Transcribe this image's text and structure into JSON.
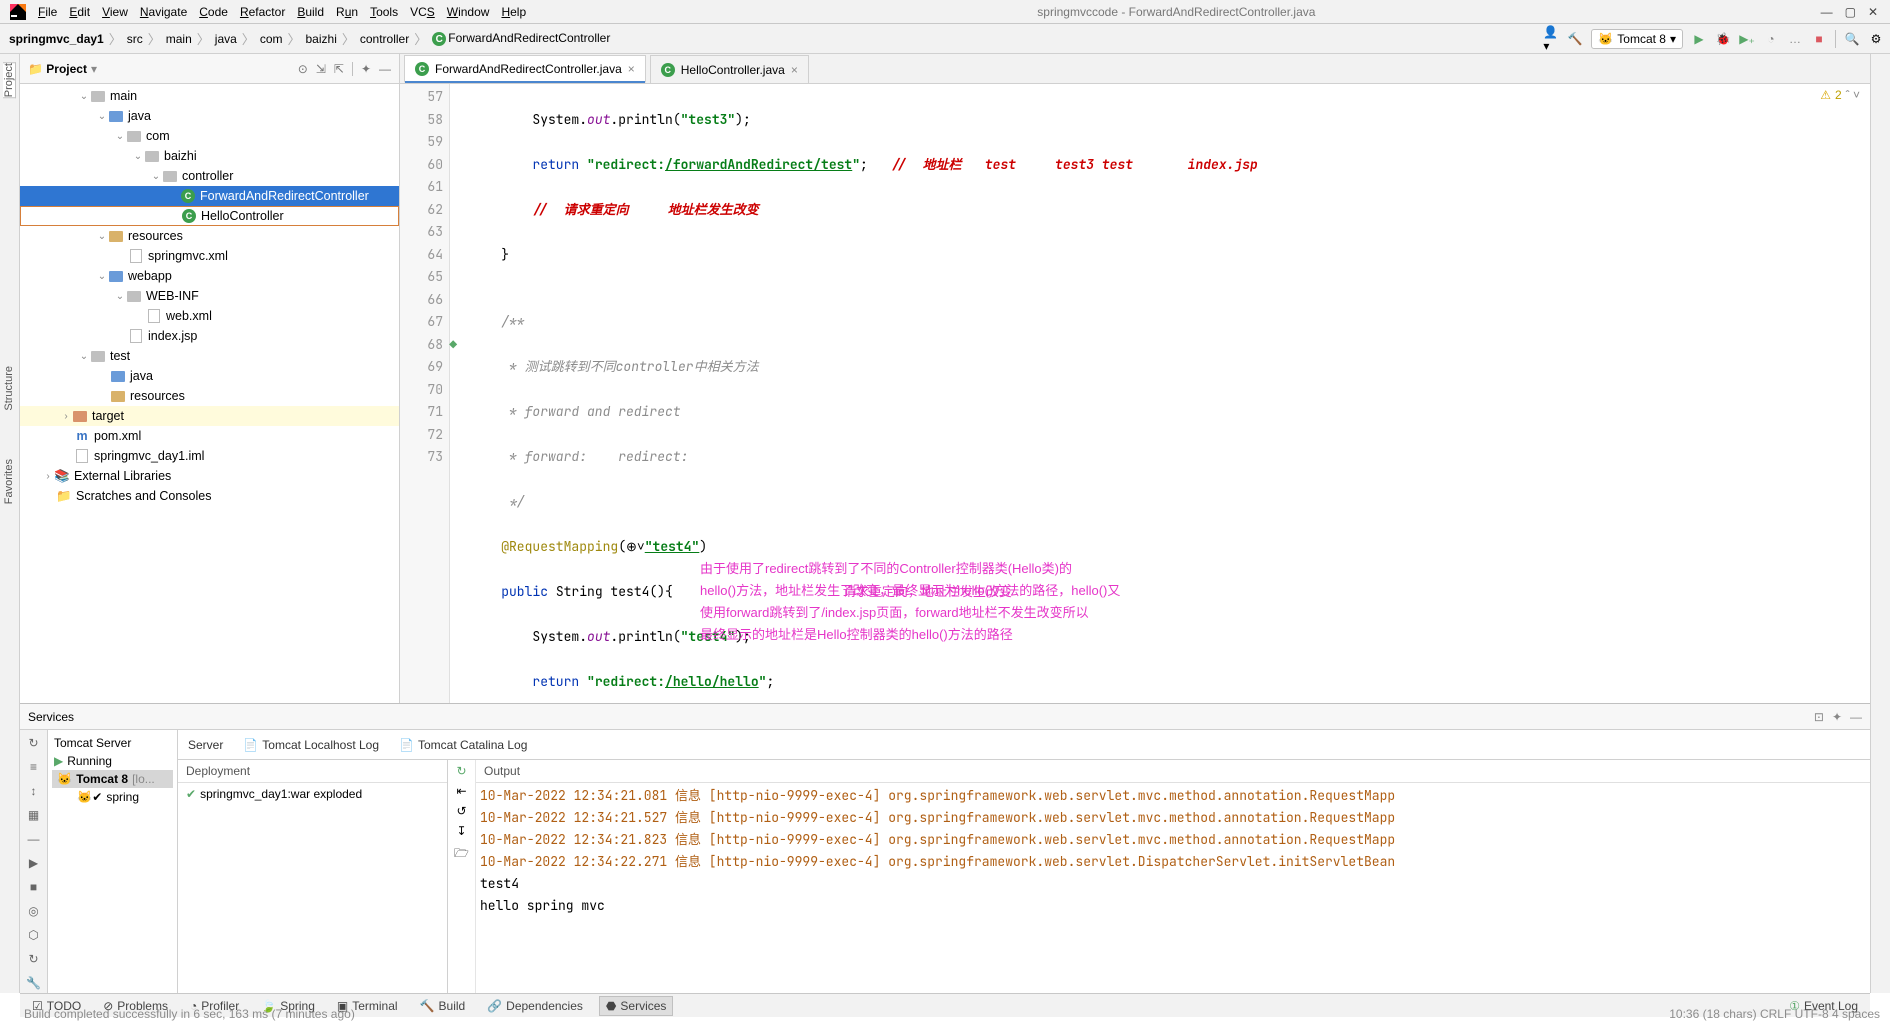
{
  "window_title": "springmvccode - ForwardAndRedirectController.java",
  "menu": [
    "File",
    "Edit",
    "View",
    "Navigate",
    "Code",
    "Refactor",
    "Build",
    "Run",
    "Tools",
    "VCS",
    "Window",
    "Help"
  ],
  "breadcrumb": [
    "springmvc_day1",
    "src",
    "main",
    "java",
    "com",
    "baizhi",
    "controller"
  ],
  "breadcrumb_class": "ForwardAndRedirectController",
  "run_config": "Tomcat 8",
  "project_panel_title": "Project",
  "tree": {
    "n0": "main",
    "n1": "java",
    "n2": "com",
    "n3": "baizhi",
    "n4": "controller",
    "n5": "ForwardAndRedirectController",
    "n6": "HelloController",
    "n7": "resources",
    "n8": "springmvc.xml",
    "n9": "webapp",
    "n10": "WEB-INF",
    "n11": "web.xml",
    "n12": "index.jsp",
    "n13": "test",
    "n14": "java",
    "n15": "resources",
    "n16": "target",
    "n17": "pom.xml",
    "n18": "springmvc_day1.iml",
    "n19": "External Libraries",
    "n20": "Scratches and Consoles"
  },
  "editor_tabs": {
    "t0": "ForwardAndRedirectController.java",
    "t1": "HelloController.java"
  },
  "gutter_lines": [
    "57",
    "58",
    "59",
    "60",
    "61",
    "62",
    "63",
    "64",
    "65",
    "66",
    "67",
    "68",
    "69",
    "70",
    "71",
    "72",
    "73"
  ],
  "code": {
    "l57a": "        System.",
    "l57b": "out",
    "l57c": ".println(",
    "l57d": "\"test3\"",
    "l57e": ");",
    "l58a": "        ",
    "l58b": "return ",
    "l58c": "\"redirect:",
    "l58d": "/forwardAndRedirect/test",
    "l58e": "\"",
    "l58f": ";",
    "l58g": "   //  地址栏   test     test3 test       index.jsp",
    "l59": "        //  请求重定向     地址栏发生改变",
    "l60": "    }",
    "l61": "",
    "l62": "    /**",
    "l63": "     * 测试跳转到不同controller中相关方法",
    "l64": "     * forward and redirect",
    "l65": "     * forward:    redirect:",
    "l66": "     */",
    "l67a": "    ",
    "l67b": "@RequestMapping",
    "l67c": "(",
    "l67d": "\"test4\"",
    "l67e": ")",
    "l68a": "    ",
    "l68b": "public ",
    "l68c": "String test4(){",
    "l69a": "        System.",
    "l69b": "out",
    "l69c": ".println(",
    "l69d": "\"test4\"",
    "l69e": ");",
    "l70a": "        ",
    "l70b": "return ",
    "l70c": "\"redirect:",
    "l70d": "/hello/hello",
    "l70e": "\"",
    "l70f": ";",
    "l71": "    }",
    "l72": "}",
    "l73": ""
  },
  "pink_note_inline": "请求重定向，地址栏发生改变",
  "pink_para_1": "由于使用了redirect跳转到了不同的Controller控制器类(Hello类)的",
  "pink_para_2": "hello()方法，地址栏发生了改变，最终显示为hello()方法的路径，hello()又",
  "pink_para_3": "使用forward跳转到了/index.jsp页面，forward地址栏不发生改变所以",
  "pink_para_4": "最终显示的地址栏是Hello控制器类的hello()方法的路径",
  "warnings_count": "2",
  "services_title": "Services",
  "sv_tabs": {
    "server": "Server",
    "tomlog": "Tomcat Localhost Log",
    "catalina": "Tomcat Catalina Log"
  },
  "sv_tree": {
    "root": "Tomcat Server",
    "running": "Running",
    "node": "Tomcat 8",
    "leaf": "spring"
  },
  "deploy_hdr": "Deployment",
  "deploy_item": "springmvc_day1:war exploded",
  "output_hdr": "Output",
  "logs": {
    "l1": "10-Mar-2022 12:34:21.081 信息 [http-nio-9999-exec-4] org.springframework.web.servlet.mvc.method.annotation.RequestMapp",
    "l2": "10-Mar-2022 12:34:21.527 信息 [http-nio-9999-exec-4] org.springframework.web.servlet.mvc.method.annotation.RequestMapp",
    "l3": "10-Mar-2022 12:34:21.823 信息 [http-nio-9999-exec-4] org.springframework.web.servlet.mvc.method.annotation.RequestMapp",
    "l4": "10-Mar-2022 12:34:22.271 信息 [http-nio-9999-exec-4] org.springframework.web.servlet.DispatcherServlet.initServletBean",
    "p1": "test4",
    "p2": "hello spring mvc"
  },
  "tool_tabs": {
    "todo": "TODO",
    "problems": "Problems",
    "profiler": "Profiler",
    "spring": "Spring",
    "terminal": "Terminal",
    "build": "Build",
    "dependencies": "Dependencies",
    "services": "Services"
  },
  "event_log": "Event Log",
  "status_left": "Build completed successfully in 6 sec, 163 ms (7 minutes ago)",
  "status_right": "10:36 (18 chars)   CRLF   UTF-8   4 spaces",
  "left_tabs": {
    "project": "Project",
    "structure": "Structure",
    "favorites": "Favorites"
  },
  "run_config_count": "[lo..."
}
